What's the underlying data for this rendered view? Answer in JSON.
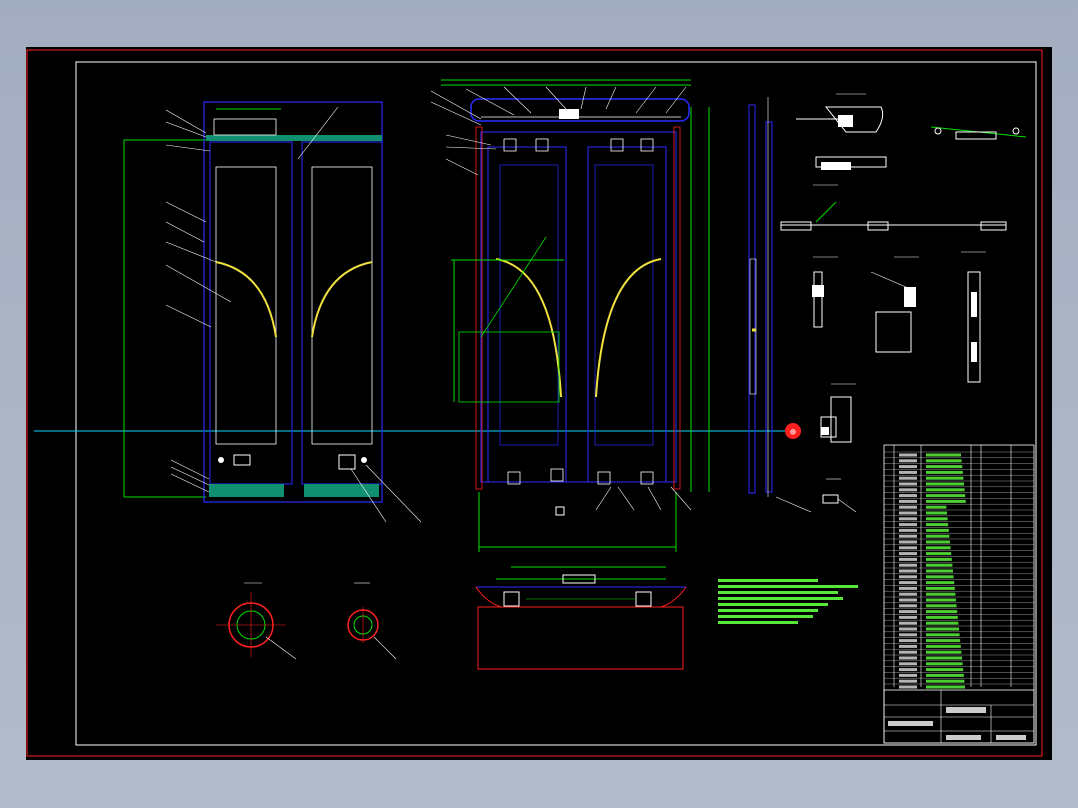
{
  "canvas": {
    "background": "#000000",
    "outside_color": "#a7b0c2",
    "sheet_border_color": "#ff2020"
  },
  "palette": {
    "door_blue": "#2a2cff",
    "dim_green": "#00e000",
    "text_white": "#ffffff",
    "center_cyan": "#00d8ff",
    "track_teal": "#109070",
    "arch_yellow": "#f0e040",
    "marker_red": "#ff2020",
    "light_green": "#60ff40"
  },
  "axis_marker": {
    "symbol": "⊕"
  },
  "icons": {
    "axis_marker": "axis-target-icon"
  }
}
